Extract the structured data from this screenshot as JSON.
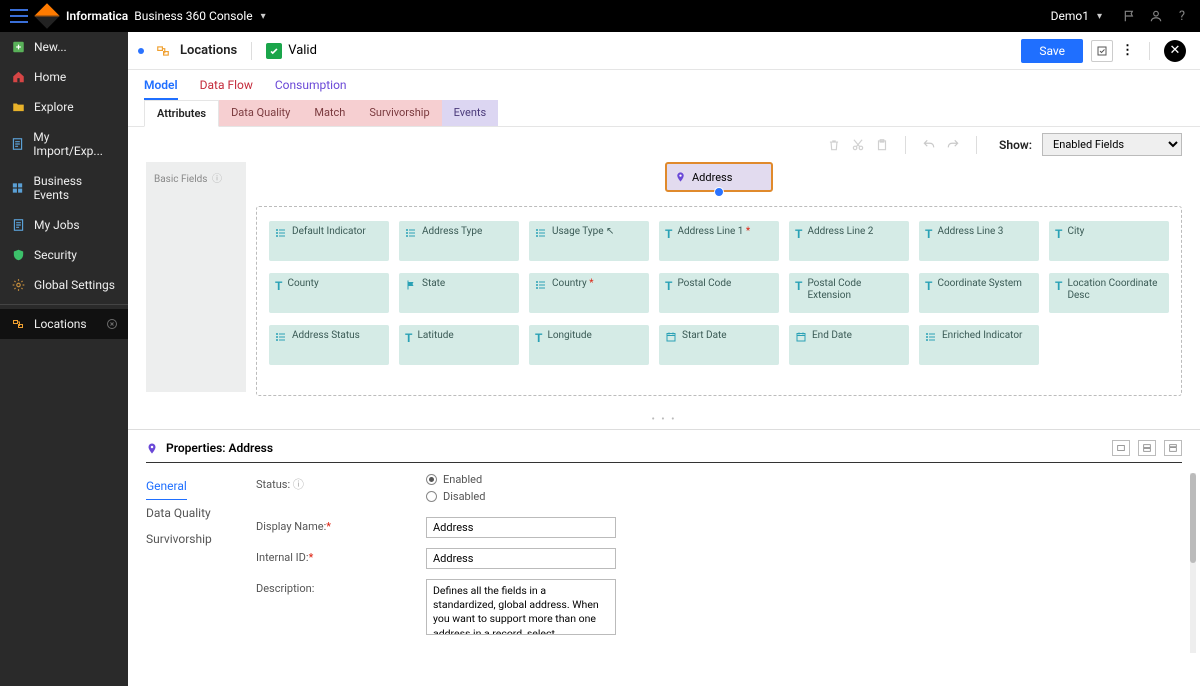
{
  "top": {
    "brand": "Informatica",
    "product": "Business 360 Console",
    "user": "Demo1"
  },
  "sidebar": {
    "items": [
      {
        "label": "New...",
        "icon": "plus",
        "color": "#59b159"
      },
      {
        "label": "Home",
        "icon": "home",
        "color": "#d64545"
      },
      {
        "label": "Explore",
        "icon": "folder",
        "color": "#e8b22a"
      },
      {
        "label": "My Import/Exp...",
        "icon": "doc",
        "color": "#5aa0d6"
      },
      {
        "label": "Business Events",
        "icon": "grid",
        "color": "#5aa0d6"
      },
      {
        "label": "My Jobs",
        "icon": "doc",
        "color": "#5aa0d6"
      },
      {
        "label": "Security",
        "icon": "shield",
        "color": "#3cc06a"
      },
      {
        "label": "Global Settings",
        "icon": "gear",
        "color": "#c08a3c"
      }
    ],
    "open": {
      "label": "Locations"
    }
  },
  "page": {
    "title": "Locations",
    "valid_label": "Valid",
    "save_label": "Save",
    "tabs1": [
      "Model",
      "Data Flow",
      "Consumption"
    ],
    "tabs1_active": 0,
    "tabs2": [
      {
        "label": "Attributes",
        "cls": "active"
      },
      {
        "label": "Data Quality",
        "cls": "pink"
      },
      {
        "label": "Match",
        "cls": "pink"
      },
      {
        "label": "Survivorship",
        "cls": "pink"
      },
      {
        "label": "Events",
        "cls": "purple"
      }
    ],
    "show_label": "Show:",
    "show_value": "Enabled Fields"
  },
  "canvas": {
    "basic_label": "Basic Fields",
    "address_chip": "Address",
    "rows": [
      [
        {
          "label": "Default Indicator",
          "icon": "list"
        },
        {
          "label": "Address Type",
          "icon": "list"
        },
        {
          "label": "Usage Type",
          "icon": "list",
          "cursor": true
        },
        {
          "label": "Address Line 1",
          "icon": "T",
          "req": true
        },
        {
          "label": "Address Line 2",
          "icon": "T"
        },
        {
          "label": "Address Line 3",
          "icon": "T"
        },
        {
          "label": "City",
          "icon": "T"
        }
      ],
      [
        {
          "label": "County",
          "icon": "T"
        },
        {
          "label": "State",
          "icon": "flag"
        },
        {
          "label": "Country",
          "icon": "list",
          "req": true
        },
        {
          "label": "Postal Code",
          "icon": "T"
        },
        {
          "label": "Postal Code Extension",
          "icon": "T"
        },
        {
          "label": "Coordinate System",
          "icon": "T"
        },
        {
          "label": "Location Coordinate Desc",
          "icon": "T"
        }
      ],
      [
        {
          "label": "Address Status",
          "icon": "list"
        },
        {
          "label": "Latitude",
          "icon": "T"
        },
        {
          "label": "Longitude",
          "icon": "T"
        },
        {
          "label": "Start Date",
          "icon": "cal"
        },
        {
          "label": "End Date",
          "icon": "cal"
        },
        {
          "label": "Enriched Indicator",
          "icon": "list"
        }
      ]
    ]
  },
  "props": {
    "title": "Properties: Address",
    "tabs": [
      "General",
      "Data Quality",
      "Survivorship"
    ],
    "status_label": "Status:",
    "enabled": "Enabled",
    "disabled": "Disabled",
    "display_name_label": "Display Name:",
    "display_name": "Address",
    "internal_id_label": "Internal ID:",
    "internal_id": "Address",
    "description_label": "Description:",
    "description": "Defines all the fields in a standardized, global address. When you want to support more than one address in a record, select"
  }
}
